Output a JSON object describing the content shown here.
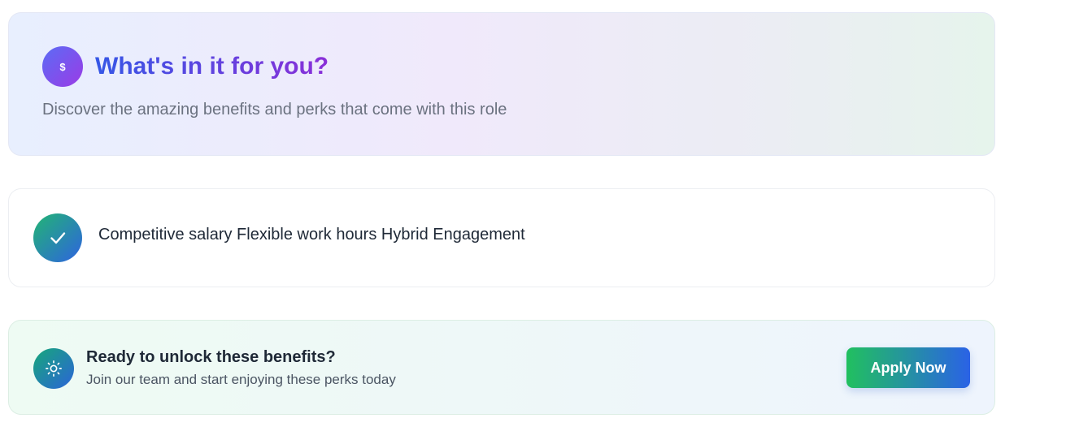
{
  "hero": {
    "icon": "dollar-icon",
    "icon_glyph": "$",
    "title": "What's in it for you?",
    "subtitle": "Discover the amazing benefits and perks that come with this role",
    "accent_start": "#3557e6",
    "accent_end": "#8a2fd8"
  },
  "benefit": {
    "icon": "check-icon",
    "text": "Competitive salary Flexible work hours Hybrid Engagement"
  },
  "cta": {
    "icon": "sun-icon",
    "title": "Ready to unlock these benefits?",
    "subtitle": "Join our team and start enjoying these perks today",
    "button_label": "Apply Now",
    "button_color_start": "#21c05f",
    "button_color_end": "#2a62e6"
  }
}
